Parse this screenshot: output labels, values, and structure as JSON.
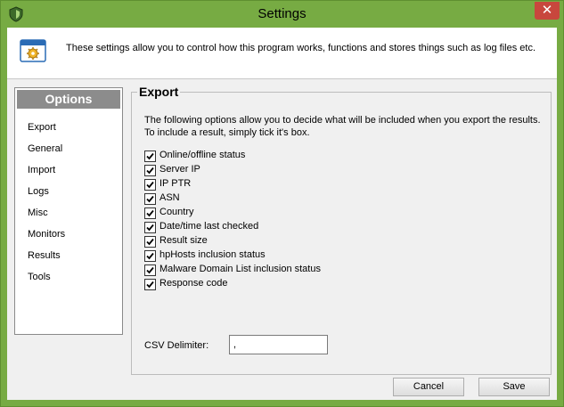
{
  "window": {
    "title": "Settings",
    "close_glyph": "✕",
    "accent_color": "#77ab43"
  },
  "header": {
    "icon": "settings-app-icon",
    "text": "These settings allow you to control how this program works, functions and stores things such as log files etc."
  },
  "sidebar": {
    "title": "Options",
    "items": [
      {
        "label": "Export"
      },
      {
        "label": "General"
      },
      {
        "label": "Import"
      },
      {
        "label": "Logs"
      },
      {
        "label": "Misc"
      },
      {
        "label": "Monitors"
      },
      {
        "label": "Results"
      },
      {
        "label": "Tools"
      }
    ]
  },
  "export": {
    "title": "Export",
    "description": "The following options allow you to decide what will be included when you export the results. To include a result, simply tick it's box.",
    "options": [
      {
        "label": "Online/offline status",
        "checked": true
      },
      {
        "label": "Server IP",
        "checked": true
      },
      {
        "label": "IP PTR",
        "checked": true
      },
      {
        "label": "ASN",
        "checked": true
      },
      {
        "label": "Country",
        "checked": true
      },
      {
        "label": "Date/time last checked",
        "checked": true
      },
      {
        "label": "Result size",
        "checked": true
      },
      {
        "label": "hpHosts inclusion status",
        "checked": true
      },
      {
        "label": "Malware Domain List inclusion status",
        "checked": true
      },
      {
        "label": "Response code",
        "checked": true
      }
    ],
    "csv_label": "CSV Delimiter:",
    "csv_value": ","
  },
  "buttons": {
    "cancel": "Cancel",
    "save": "Save"
  }
}
